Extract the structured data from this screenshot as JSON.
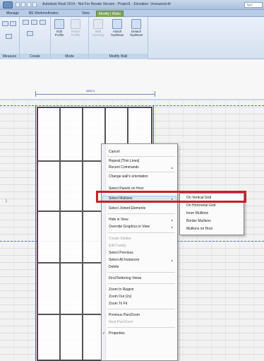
{
  "window": {
    "title": "Autodesk Revit 2014 - Not For Resale Version - Project1 - Elevation: Vooraanzicht",
    "search_placeholder": "Type"
  },
  "ribbon_tabs": [
    "Manage",
    "BE Werkmethoden",
    "View",
    "Modify | Walls"
  ],
  "ribbon": {
    "panels": {
      "measure": "Measure",
      "create": "Create",
      "mode": "Mode",
      "modify_wall": "Modify Wall"
    },
    "buttons": {
      "edit_profile": "Edit Profile",
      "reset_profile": "Reset Profile",
      "wall_opening": "Wall Opening",
      "attach_top_base": "Attach Top/Base",
      "detach_top_base": "Detach Top/Base"
    }
  },
  "canvas": {
    "dimension_text": "2600.0"
  },
  "context_menu": {
    "items": [
      {
        "label": "Cancel"
      },
      {
        "label": "Repeat [Thin Lines]"
      },
      {
        "label": "Recent Commands",
        "submenu": true
      },
      {
        "label": "Change wall's orientation"
      },
      {
        "label": "Select Panels on Host"
      },
      {
        "label": "Select Mullions",
        "submenu": true
      },
      {
        "label": "Select Joined Elements"
      },
      {
        "label": "Hide in View",
        "submenu": true
      },
      {
        "label": "Override Graphics in View",
        "submenu": true
      },
      {
        "label": "Create Similar",
        "disabled": true
      },
      {
        "label": "Edit Family",
        "disabled": true
      },
      {
        "label": "Select Previous"
      },
      {
        "label": "Select All Instances",
        "submenu": true
      },
      {
        "label": "Delete"
      },
      {
        "label": "Find Referring Views"
      },
      {
        "label": "Zoom In Region"
      },
      {
        "label": "Zoom Out (2x)"
      },
      {
        "label": "Zoom To Fit"
      },
      {
        "label": "Previous Pan/Zoom"
      },
      {
        "label": "Next Pan/Zoom",
        "disabled": true
      },
      {
        "label": "Properties",
        "checked": true
      }
    ],
    "submenu_arrow": "▸",
    "check_mark": "✓"
  },
  "mullions_submenu": {
    "items": [
      "On Vertical Grid",
      "On Horizontal Grid",
      "Inner Mullions",
      "Border Mullions",
      "Mullions on Host"
    ]
  }
}
